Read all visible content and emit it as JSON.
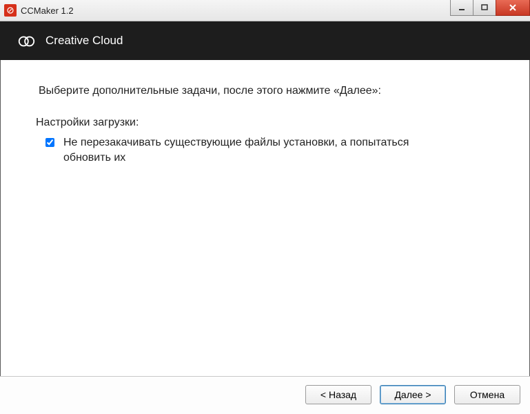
{
  "window": {
    "title": "CCMaker 1.2"
  },
  "banner": {
    "title": "Creative Cloud"
  },
  "content": {
    "instruction": "Выберите дополнительные задачи, после этого нажмите «Далее»:",
    "settings_header": "Настройки загрузки:",
    "option1_label": "Не перезакачивать существующие файлы установки, а попытаться обновить их",
    "option1_checked": true
  },
  "footer": {
    "back": "< Назад",
    "next": "Далее >",
    "cancel": "Отмена"
  }
}
